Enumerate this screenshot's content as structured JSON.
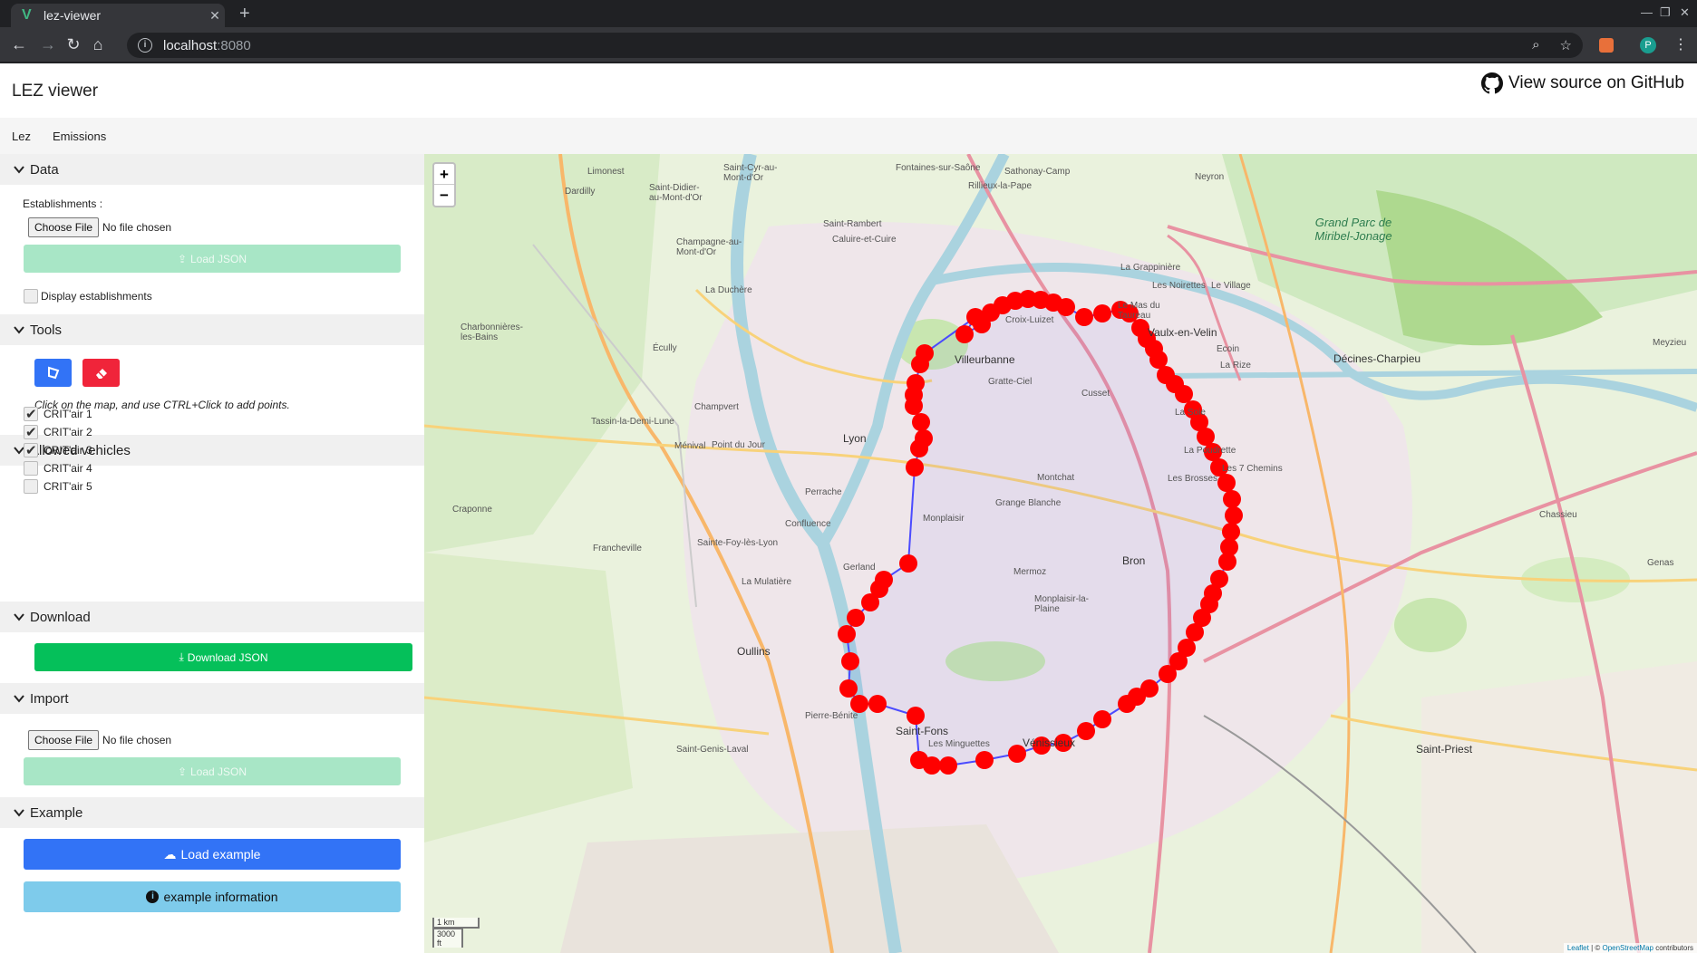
{
  "browser": {
    "tab_title": "lez-viewer",
    "url_host": "localhost",
    "url_port": ":8080",
    "profile_initial": "P"
  },
  "app": {
    "title": "LEZ viewer",
    "github_link": "View source on GitHub",
    "tabs": [
      "Lez",
      "Emissions"
    ]
  },
  "sidebar": {
    "data": {
      "heading": "Data",
      "establishments_label": "Establishments :",
      "choose_file": "Choose File",
      "no_file": "No file chosen",
      "load_json": "Load JSON",
      "display_establishments": "Display establishments"
    },
    "tools": {
      "heading": "Tools",
      "hint": "Click on the map, and use CTRL+Click to add points."
    },
    "allowed_vehicles": {
      "heading": "Allowed vehicles",
      "items": [
        {
          "label": "CRIT'air 1",
          "checked": true
        },
        {
          "label": "CRIT'air 2",
          "checked": true
        },
        {
          "label": "CRIT'air 3",
          "checked": true
        },
        {
          "label": "CRIT'air 4",
          "checked": false
        },
        {
          "label": "CRIT'air 5",
          "checked": false
        }
      ]
    },
    "download": {
      "heading": "Download",
      "button": "Download JSON"
    },
    "import": {
      "heading": "Import",
      "choose_file": "Choose File",
      "no_file": "No file chosen",
      "load_json": "Load JSON"
    },
    "example": {
      "heading": "Example",
      "load_button": "Load example",
      "info_button": "example information"
    }
  },
  "map": {
    "zoom_in": "+",
    "zoom_out": "−",
    "scale_km": "1 km",
    "scale_ft": "3000 ft",
    "attribution_leaflet": "Leaflet",
    "attribution_sep": " | © ",
    "attribution_osm": "OpenStreetMap",
    "attribution_tail": " contributors",
    "labels": [
      "Lyon",
      "Villeurbanne",
      "Caluire-et-Cuire",
      "Écully",
      "Tassin-la-Demi-Lune",
      "Sainte-Foy-lès-Lyon",
      "Oullins",
      "Saint-Fons",
      "Vénissieux",
      "Bron",
      "Vaulx-en-Velin",
      "Décines-Charpieu",
      "Meyzieu",
      "Saint-Priest",
      "Genas",
      "Gerland",
      "Monplaisir",
      "Mermoz",
      "Grange Blanche",
      "Montchat",
      "Gratte-Ciel",
      "Croix-Luizet",
      "Cusset",
      "La Soie",
      "Charbonnières-les-Bains",
      "Francheville",
      "Champagne-au-Mont-d'Or",
      "Saint-Rambert",
      "Rillieux-la-Pape",
      "Neyron",
      "Grand Parc de Miribel-Jonage",
      "Chassieu",
      "Perrache",
      "Confluence",
      "La Mulatière",
      "Les Minguettes",
      "Saint-Genis-Laval",
      "Craponne",
      "Dardilly",
      "Limonest",
      "Sathonay-Camp",
      "Saint-Cyr-au-Mont-d'Or",
      "Saint-Didier-au-Mont-d'Or",
      "Fontaines-sur-Saône",
      "La Duchère",
      "Pierre-Bénite",
      "Point du Jour",
      "Ménival",
      "Champvert",
      "Monplaisir-la-Plaine",
      "Les Brosses",
      "La Poudrette",
      "Les 7 Chemins",
      "Ecoin",
      "La Rize",
      "Le Mas du Taureau",
      "Les Noirettes",
      "La Grappinière",
      "Le Village"
    ],
    "route_color": "#ff0000"
  }
}
